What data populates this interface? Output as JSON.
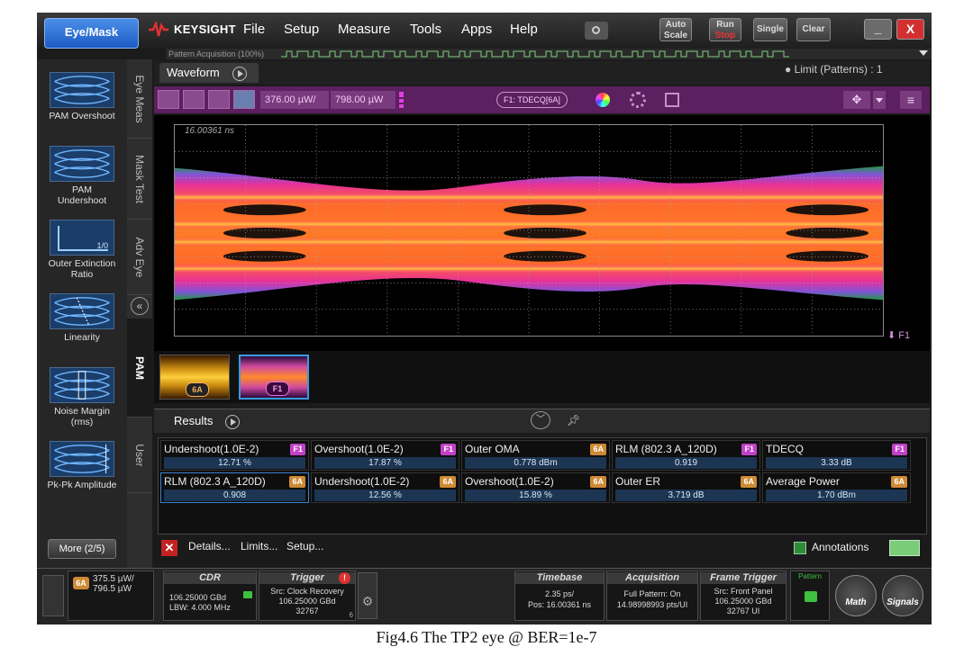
{
  "topbar": {
    "mode_button": "Eye/Mask",
    "brand": "KEYSIGHT",
    "menu": [
      "File",
      "Setup",
      "Measure",
      "Tools",
      "Apps",
      "Help"
    ],
    "auto_scale_label": "Auto Scale",
    "run_label": "Run",
    "stop_label": "Stop",
    "single_label": "Single",
    "clear_label": "Clear",
    "minimize_glyph": "_",
    "close_glyph": "X"
  },
  "pattern_strip": {
    "text": "Pattern Acquisition (100%)"
  },
  "left_panel": {
    "items": [
      {
        "label": "PAM Overshoot"
      },
      {
        "label": "PAM Undershoot"
      },
      {
        "label": "Outer Extinction Ratio",
        "icon_text": "1/0"
      },
      {
        "label": "Linearity"
      },
      {
        "label": "Noise Margin (rms)"
      },
      {
        "label": "Pk-Pk Amplitude"
      }
    ],
    "more_button": "More (2/5)"
  },
  "vertical_tabs": [
    "Eye Meas",
    "Mask Test",
    "Adv Eye",
    "PAM",
    "User"
  ],
  "collapse_glyph": "«",
  "waveform": {
    "tab_label": "Waveform",
    "limit_text": "● Limit (Patterns) : 1",
    "scale1": "376.00 µW/",
    "scale2": "798.00 µW",
    "chip": "F1: TDECQ[6A]",
    "timestamp": "16.00361 ns",
    "marker": "F1",
    "thumbnails": [
      {
        "badge": "6A"
      },
      {
        "badge": "F1"
      }
    ]
  },
  "results": {
    "title": "Results",
    "rows": [
      [
        {
          "name": "Undershoot(1.0E-2)",
          "badge": "F1",
          "value": "12.71 %"
        },
        {
          "name": "Overshoot(1.0E-2)",
          "badge": "F1",
          "value": "17.87 %"
        },
        {
          "name": "Outer OMA",
          "badge": "6A",
          "value": "0.778 dBm"
        },
        {
          "name": "RLM (802.3 A_120D)",
          "badge": "F1",
          "value": "0.919"
        },
        {
          "name": "TDECQ",
          "badge": "F1",
          "value": "3.33 dB"
        }
      ],
      [
        {
          "name": "RLM (802.3 A_120D)",
          "badge": "6A",
          "value": "0.908"
        },
        {
          "name": "Undershoot(1.0E-2)",
          "badge": "6A",
          "value": "12.56 %"
        },
        {
          "name": "Overshoot(1.0E-2)",
          "badge": "6A",
          "value": "15.89 %"
        },
        {
          "name": "Outer ER",
          "badge": "6A",
          "value": "3.719 dB"
        },
        {
          "name": "Average Power",
          "badge": "6A",
          "value": "1.70 dBm"
        }
      ]
    ],
    "footer": {
      "details": "Details...",
      "limits": "Limits...",
      "setup": "Setup...",
      "annotations": "Annotations"
    }
  },
  "status_bar": {
    "channel": {
      "badge": "6A",
      "line1": "375.5 µW/",
      "line2": "796.5 µW"
    },
    "cdr": {
      "title": "CDR",
      "line1": "106.25000 GBd",
      "line2": "LBW: 4.000 MHz"
    },
    "trigger": {
      "title": "Trigger",
      "line1": "Src: Clock Recovery",
      "line2": "106.25000 GBd",
      "line3": "32767",
      "corner": "6"
    },
    "timebase": {
      "title": "Timebase",
      "line1": "2.35 ps/",
      "line2": "Pos: 16.00361 ns"
    },
    "acquisition": {
      "title": "Acquisition",
      "line1": "Full Pattern: On",
      "line2": "14.98998993 pts/UI"
    },
    "frame_trigger": {
      "title": "Frame Trigger",
      "line1": "Src: Front Panel",
      "line2": "106.25000 GBd",
      "line3": "32767 UI"
    },
    "pattern_label": "Pattern",
    "math": "Math",
    "signals": "Signals"
  },
  "caption": "Fig4.6 The TP2 eye @ BER=1e-7",
  "colors": {
    "accent_purple": "#5c1f5f",
    "badge_f1": "#c241c7",
    "badge_6a": "#ce8a34"
  }
}
